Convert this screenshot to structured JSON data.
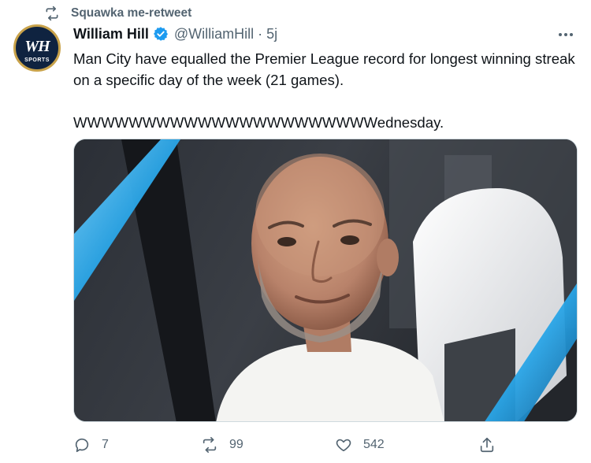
{
  "retweet_context": {
    "label": "Squawka me-retweet",
    "icon": "retweet-icon"
  },
  "author": {
    "name": "William Hill",
    "handle": "@WilliamHill",
    "separator": "·",
    "time": "5j",
    "verified": true,
    "avatar": {
      "monogram": "WH",
      "caption": "SPORTS"
    }
  },
  "tweet": {
    "line1": "Man City have equalled the Premier League record for longest winning streak",
    "line2": "on a specific day of the week (21 games).",
    "line3": "WWWWWWWWWWWWWWWWWWWWWWednesday."
  },
  "actions": {
    "reply_count": "7",
    "retweet_count": "99",
    "like_count": "542"
  },
  "colors": {
    "verified": "#1d9bf0",
    "secondary_text": "#536471",
    "accent_blue": "#2aa6e8"
  }
}
